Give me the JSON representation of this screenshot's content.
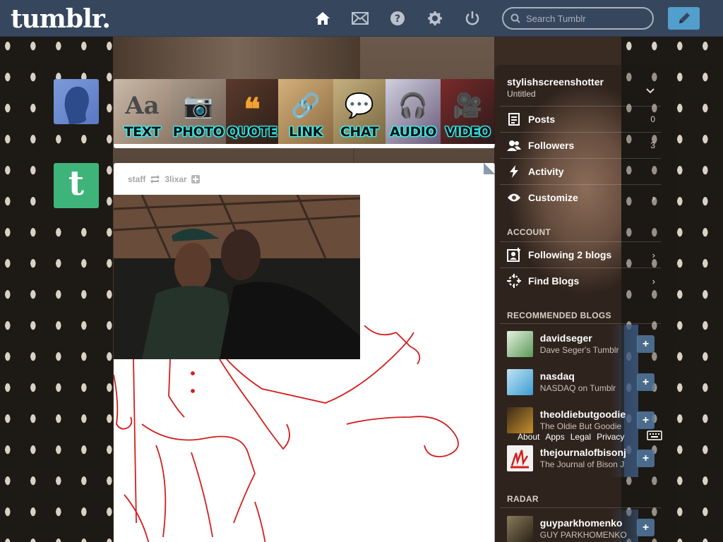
{
  "header": {
    "logo": "tumblr.",
    "search_placeholder": "Search Tumblr",
    "nav": [
      "home-icon",
      "mail-icon",
      "help-icon",
      "gear-icon",
      "power-icon"
    ],
    "compose": "pencil-icon"
  },
  "post_types": [
    {
      "label": "TEXT",
      "glyph": "Aa",
      "color": "#444444"
    },
    {
      "label": "PHOTO",
      "glyph": "📷",
      "color": "#d9534f"
    },
    {
      "label": "QUOTE",
      "glyph": "❝",
      "color": "#f0a030"
    },
    {
      "label": "LINK",
      "glyph": "🔗",
      "color": "#5cb85c"
    },
    {
      "label": "CHAT",
      "glyph": "💬",
      "color": "#5bc0de"
    },
    {
      "label": "AUDIO",
      "glyph": "🎧",
      "color": "#9b59b6"
    },
    {
      "label": "VIDEO",
      "glyph": "🎥",
      "color": "#999999"
    }
  ],
  "post": {
    "author": "staff",
    "reblogged_from": "3lixar"
  },
  "sidebar": {
    "blog_name": "stylishscreenshotter",
    "blog_subtitle": "Untitled",
    "rows": [
      {
        "label": "Posts",
        "count": "0",
        "icon": "posts-icon"
      },
      {
        "label": "Followers",
        "count": "3",
        "icon": "followers-icon"
      },
      {
        "label": "Activity",
        "count": "",
        "icon": "activity-icon"
      },
      {
        "label": "Customize",
        "count": "",
        "icon": "eye-icon",
        "arrow": true
      }
    ],
    "account_heading": "ACCOUNT",
    "account_rows": [
      {
        "label": "Following 2 blogs",
        "icon": "following-icon"
      },
      {
        "label": "Find Blogs",
        "icon": "find-blogs-icon"
      }
    ],
    "recommended_heading": "RECOMMENDED BLOGS",
    "recommended": [
      {
        "name": "davidseger",
        "desc": "Dave Seger's Tumblr",
        "color": "#7cb87a"
      },
      {
        "name": "nasdaq",
        "desc": "NASDAQ on Tumblr",
        "color": "#4aa3d8"
      },
      {
        "name": "theoldiebutgoodie",
        "desc": "The Oldie But Goodie",
        "color": "#8a6a3a"
      },
      {
        "name": "thejournalofbisonj",
        "desc": "The Journal of Bison J",
        "color": "#e9e9e9"
      }
    ],
    "footer_links": [
      "About",
      "Apps",
      "Legal",
      "Privacy"
    ],
    "radar_heading": "RADAR",
    "radar": {
      "name": "guyparkhomenko",
      "desc": "GUY PARKHOMENKO"
    }
  }
}
